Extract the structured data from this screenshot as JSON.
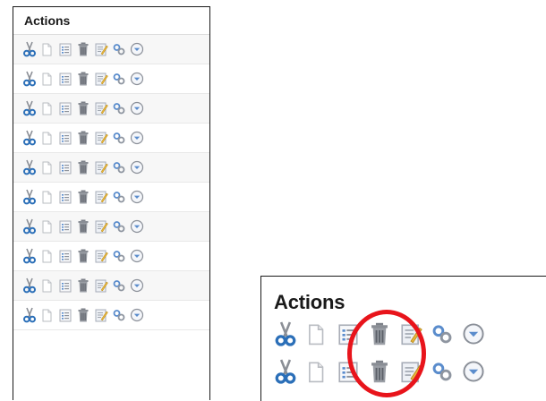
{
  "main_panel": {
    "title": "Actions",
    "row_count": 10,
    "icons": [
      "cut-icon",
      "copy-icon",
      "list-icon",
      "delete-icon",
      "edit-icon",
      "link-icon",
      "dropdown-icon"
    ]
  },
  "zoom_panel": {
    "title": "Actions",
    "icons": [
      "cut-icon",
      "copy-icon",
      "list-icon",
      "delete-icon",
      "edit-icon",
      "link-icon",
      "dropdown-icon"
    ],
    "highlighted_icons": [
      "list-icon",
      "delete-icon"
    ]
  },
  "colors": {
    "highlight": "#e8141b",
    "scissors_blue": "#2b6fb8",
    "icon_grey": "#8b8f96",
    "dropdown_blue": "#5a8ccc"
  }
}
